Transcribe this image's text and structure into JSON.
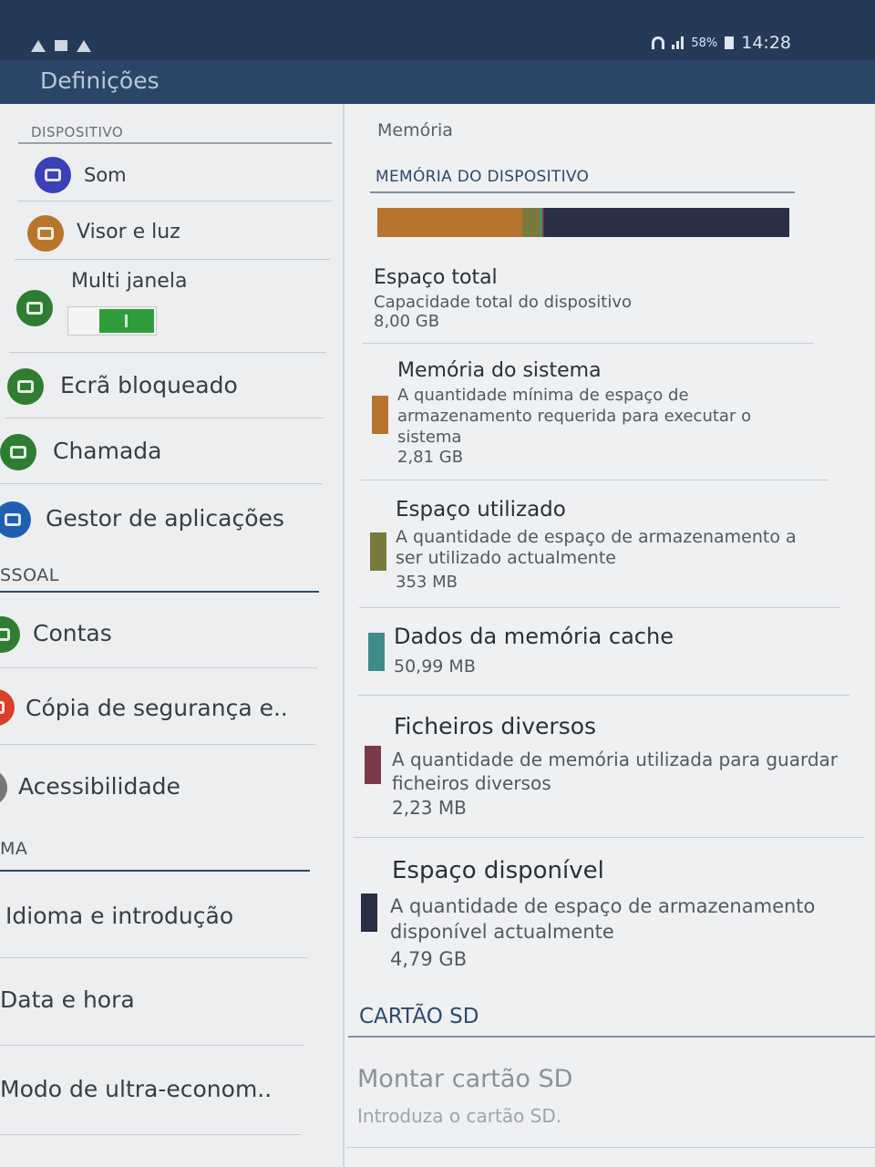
{
  "status": {
    "battery": "58%",
    "time": "14:28"
  },
  "appbar": {
    "title": "Definições"
  },
  "left": {
    "sections": [
      {
        "header": "DISPOSITIVO"
      },
      {
        "header": "SSOAL"
      },
      {
        "header": "MA"
      }
    ],
    "items": [
      {
        "label": "Som",
        "icon": "volume-icon",
        "color": "#3b3fb8"
      },
      {
        "label": "Visor e luz",
        "icon": "display-icon",
        "color": "#b8762a"
      },
      {
        "label": "Multi janela",
        "icon": "multi-window-icon",
        "color": "#2e7d32"
      },
      {
        "label": "Ecrã bloqueado",
        "icon": "lock-screen-icon",
        "color": "#2e7d32"
      },
      {
        "label": "Chamada",
        "icon": "phone-icon",
        "color": "#2e7d32"
      },
      {
        "label": "Gestor de aplicações",
        "icon": "apps-grid-icon",
        "color": "#1f5fb0"
      },
      {
        "label": "Contas",
        "icon": "accounts-icon",
        "color": "#2e7d32"
      },
      {
        "label": "Cópia de segurança e..",
        "icon": "backup-icon",
        "color": "#d8402c"
      },
      {
        "label": "Acessibilidade",
        "icon": "accessibility-icon",
        "color": "#777777"
      },
      {
        "label": "Idioma e introdução",
        "icon": "",
        "color": ""
      },
      {
        "label": "Data e hora",
        "icon": "",
        "color": ""
      },
      {
        "label": "Modo de ultra-econom..",
        "icon": "",
        "color": ""
      }
    ]
  },
  "right": {
    "title": "Memória",
    "device_section": "MEMÓRIA DO DISPOSITIVO",
    "usage_bar": [
      {
        "name": "Memória do sistema",
        "fraction": 0.351,
        "color": "#b8742e"
      },
      {
        "name": "Espaço utilizado",
        "fraction": 0.044,
        "color": "#7a7a3e"
      },
      {
        "name": "Dados da memória cache",
        "fraction": 0.006,
        "color": "#3f8b8a"
      },
      {
        "name": "Ficheiros diversos",
        "fraction": 0.003,
        "color": "#7a3a48"
      },
      {
        "name": "Espaço disponível",
        "fraction": 0.596,
        "color": "#2a2f45"
      }
    ],
    "total": {
      "title": "Espaço total",
      "desc": "Capacidade total do dispositivo",
      "value": "8,00 GB"
    },
    "entries": [
      {
        "title": "Memória do sistema",
        "desc": "A quantidade mínima de espaço de armazenamento requerida para executar o sistema",
        "value": "2,81 GB",
        "color": "#b8742e"
      },
      {
        "title": "Espaço utilizado",
        "desc": "A quantidade de espaço de armazenamento a ser utilizado actualmente",
        "value": "353 MB",
        "color": "#7a7a3e"
      },
      {
        "title": "Dados da memória cache",
        "desc": "",
        "value": "50,99 MB",
        "color": "#3f8b8a"
      },
      {
        "title": "Ficheiros diversos",
        "desc": "A quantidade de memória utilizada para guardar ficheiros diversos",
        "value": "2,23 MB",
        "color": "#7a3a48"
      },
      {
        "title": "Espaço disponível",
        "desc": "A quantidade de espaço de armazenamento disponível actualmente",
        "value": "4,79 GB",
        "color": "#2a2f45"
      }
    ],
    "sd_section": "CARTÃO SD",
    "mount": {
      "title": "Montar cartão SD",
      "desc": "Introduza o cartão SD."
    }
  }
}
